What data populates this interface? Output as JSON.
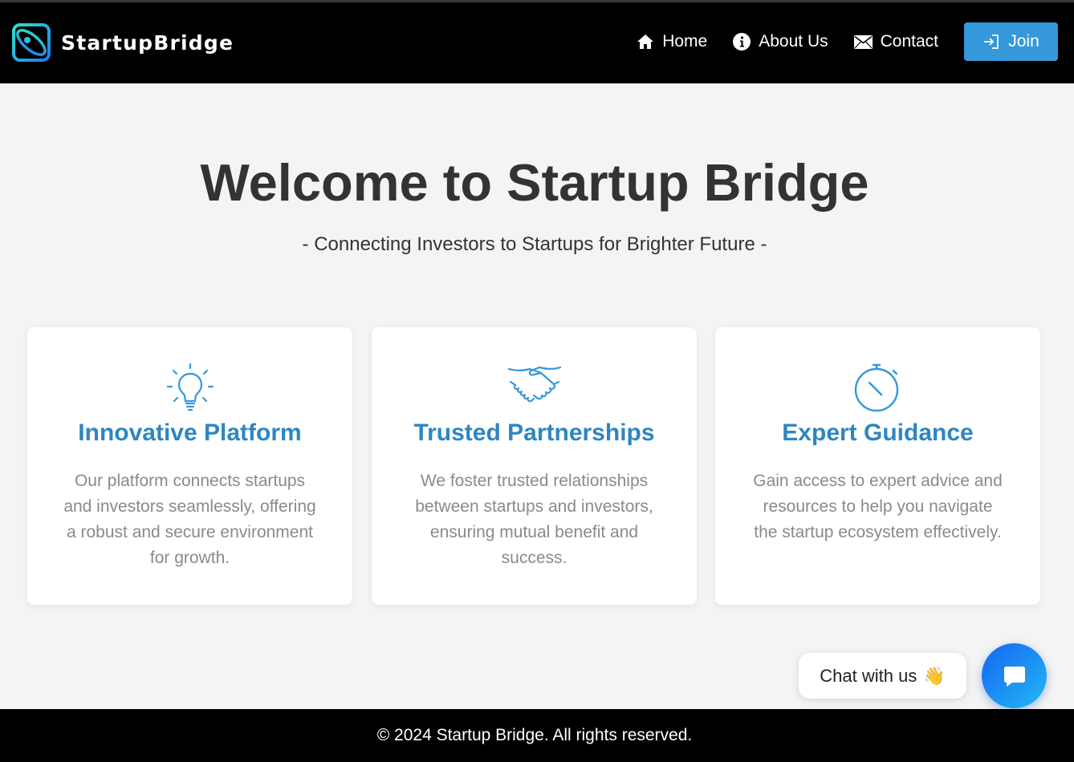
{
  "header": {
    "brand_name": "StartupBridge",
    "nav": [
      {
        "label": "Home",
        "icon": "home-icon"
      },
      {
        "label": "About Us",
        "icon": "info-icon"
      },
      {
        "label": "Contact",
        "icon": "envelope-icon"
      }
    ],
    "join_label": "Join"
  },
  "hero": {
    "title": "Welcome to Startup Bridge",
    "subtitle": "- Connecting Investors to Startups for Brighter Future -"
  },
  "cards": [
    {
      "icon": "lightbulb-icon",
      "title": "Innovative Platform",
      "text": "Our platform connects startups and investors seamlessly, offering a robust and secure environment for growth."
    },
    {
      "icon": "handshake-icon",
      "title": "Trusted Partnerships",
      "text": "We foster trusted relationships between startups and investors, ensuring mutual benefit and success."
    },
    {
      "icon": "stopwatch-icon",
      "title": "Expert Guidance",
      "text": "Gain access to expert advice and resources to help you navigate the startup ecosystem effectively."
    }
  ],
  "chat": {
    "label": "Chat with us",
    "emoji": "👋"
  },
  "footer": {
    "text": "© 2024 Startup Bridge. All rights reserved."
  },
  "colors": {
    "accent": "#3498db",
    "card_title": "#2e86c1",
    "header_bg": "#000000",
    "page_bg": "#f4f4f4"
  }
}
